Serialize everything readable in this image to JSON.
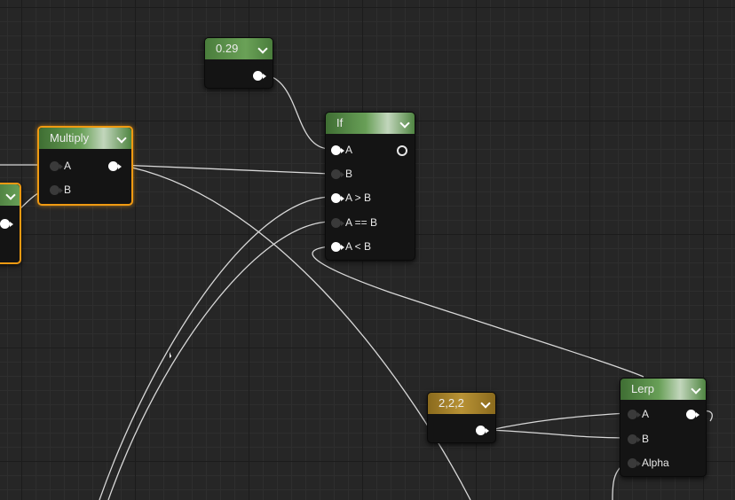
{
  "nodes": {
    "const_029": {
      "label": "0.29"
    },
    "multiply": {
      "label": "Multiply",
      "inputs": [
        "A",
        "B"
      ]
    },
    "if": {
      "label": "If",
      "inputs": [
        "A",
        "B",
        "A > B",
        "A == B",
        "A < B"
      ]
    },
    "const_222": {
      "label": "2,2,2"
    },
    "lerp": {
      "label": "Lerp",
      "inputs": [
        "A",
        "B",
        "Alpha"
      ]
    }
  },
  "colors": {
    "background": "#262626",
    "scalar_header": "#5c8f4b",
    "vector_header": "#a8842c",
    "selected_border": "#f09a12",
    "wire": "#e0e0e0"
  }
}
